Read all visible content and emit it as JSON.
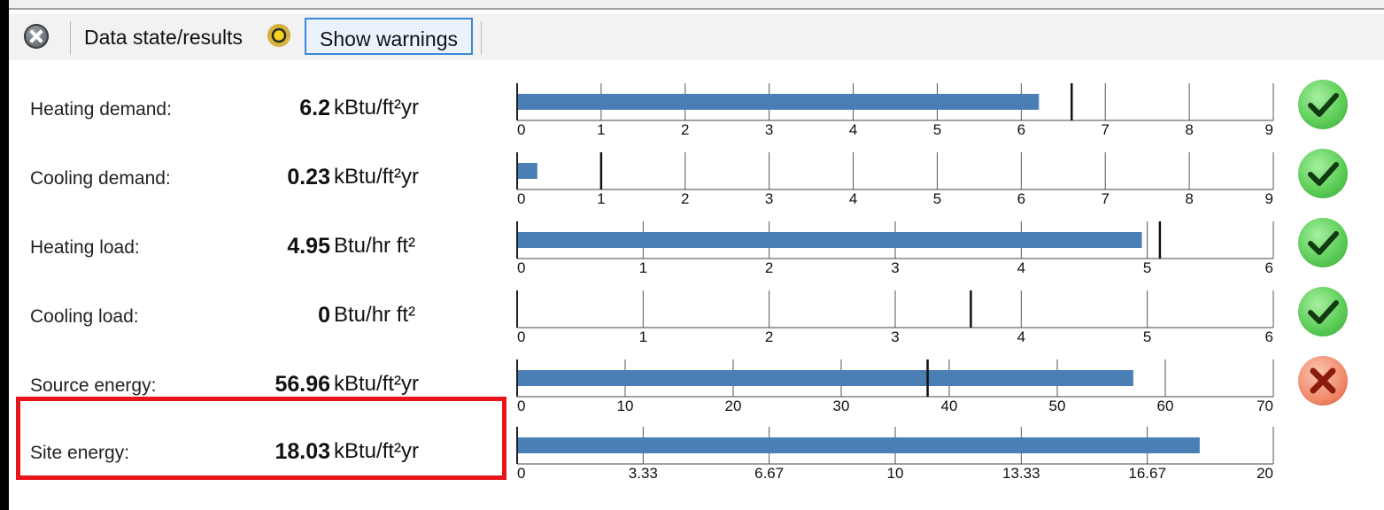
{
  "toolbar": {
    "data_state_label": "Data state/results",
    "show_warnings_label": "Show warnings"
  },
  "metrics": [
    {
      "label": "Heating demand:",
      "value": "6.2",
      "unit": "kBtu/ft²yr",
      "status": "pass",
      "status_icon": "check-icon",
      "bar_value": 6.2,
      "requirement": 6.6,
      "axis_max": 9,
      "ticks": [
        "0",
        "1",
        "2",
        "3",
        "4",
        "5",
        "6",
        "7",
        "8",
        "9"
      ]
    },
    {
      "label": "Cooling demand:",
      "value": "0.23",
      "unit": "kBtu/ft²yr",
      "status": "pass",
      "status_icon": "check-icon",
      "bar_value": 0.23,
      "requirement": 1.0,
      "axis_max": 9,
      "ticks": [
        "0",
        "1",
        "2",
        "3",
        "4",
        "5",
        "6",
        "7",
        "8",
        "9"
      ]
    },
    {
      "label": "Heating load:",
      "value": "4.95",
      "unit": "Btu/hr ft²",
      "status": "pass",
      "status_icon": "check-icon",
      "bar_value": 4.95,
      "requirement": 5.1,
      "axis_max": 6,
      "ticks": [
        "0",
        "1",
        "2",
        "3",
        "4",
        "5",
        "6"
      ]
    },
    {
      "label": "Cooling load:",
      "value": "0",
      "unit": "Btu/hr ft²",
      "status": "pass",
      "status_icon": "check-icon",
      "bar_value": 0,
      "requirement": 3.6,
      "axis_max": 6,
      "ticks": [
        "0",
        "1",
        "2",
        "3",
        "4",
        "5",
        "6"
      ]
    },
    {
      "label": "Source energy:",
      "value": "56.96",
      "unit": "kBtu/ft²yr",
      "status": "fail",
      "status_icon": "x-icon",
      "bar_value": 56.96,
      "requirement": 38,
      "axis_max": 70,
      "ticks": [
        "0",
        "10",
        "20",
        "30",
        "40",
        "50",
        "60",
        "70"
      ]
    },
    {
      "label": "Site energy:",
      "value": "18.03",
      "unit": "kBtu/ft²yr",
      "status": "none",
      "status_icon": "",
      "bar_value": 18.03,
      "requirement": null,
      "axis_max": 20,
      "ticks": [
        "0",
        "3.33",
        "6.67",
        "10",
        "13.33",
        "16.67",
        "20"
      ]
    }
  ],
  "colors": {
    "bar": "#4a7fb5",
    "highlight": "#e8141a",
    "pass": "#5fcf5a",
    "fail": "#f08a6a"
  }
}
